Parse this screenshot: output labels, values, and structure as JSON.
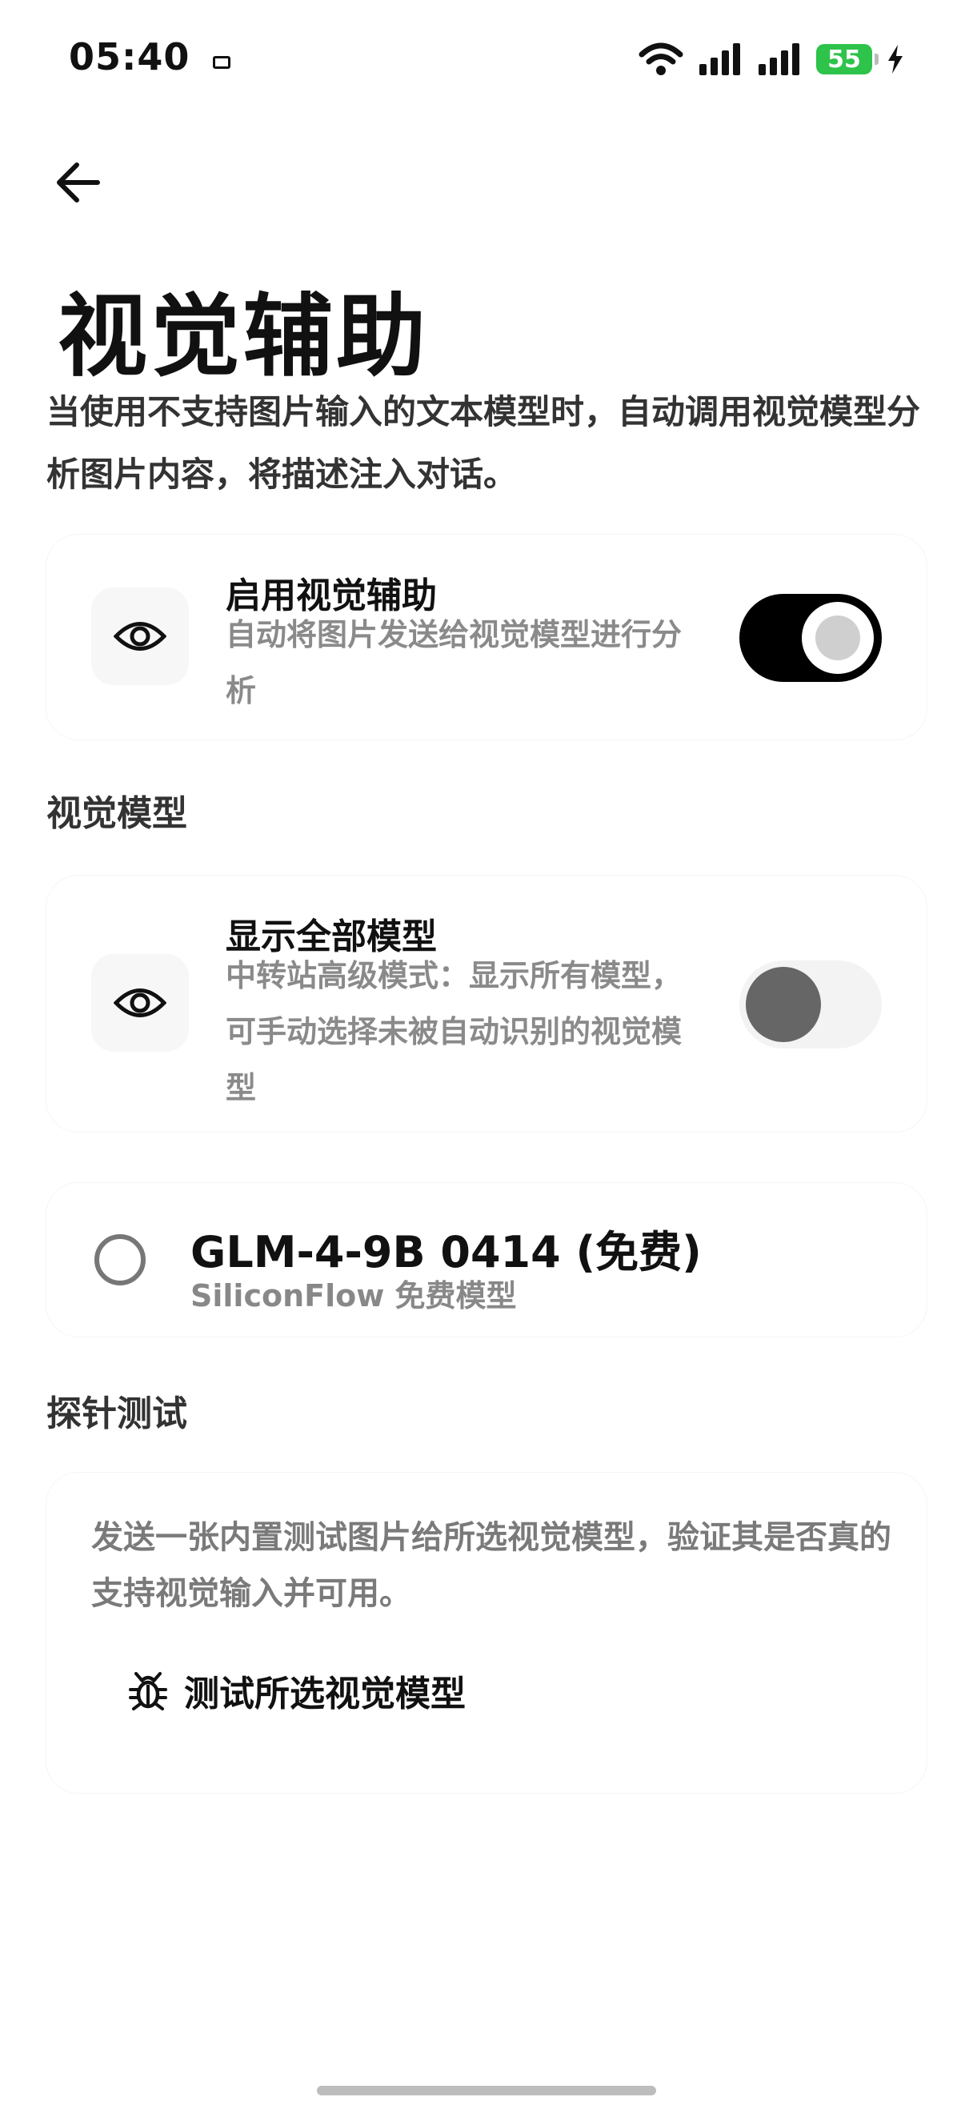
{
  "status_bar": {
    "time": "05:40",
    "battery": "55"
  },
  "header": {
    "back_icon": "arrow-left-icon",
    "title": "视觉辅助",
    "description": "当使用不支持图片输入的文本模型时，自动调用视觉模型分析图片内容，将描述注入对话。"
  },
  "enable_card": {
    "icon": "eye-icon",
    "title": "启用视觉辅助",
    "subtitle": "自动将图片发送给视觉模型进行分析",
    "enabled": true
  },
  "vision_model_section": {
    "label": "视觉模型",
    "show_all": {
      "icon": "eye-icon",
      "title": "显示全部模型",
      "subtitle": "中转站高级模式：显示所有模型，可手动选择未被自动识别的视觉模型",
      "enabled": false
    },
    "models": [
      {
        "name": "GLM-4-9B 0414 (免费)",
        "provider": "SiliconFlow 免费模型",
        "selected": false
      }
    ]
  },
  "probe_section": {
    "label": "探针测试",
    "description": "发送一张内置测试图片给所选视觉模型，验证其是否真的支持视觉输入并可用。",
    "button_icon": "bug-icon",
    "button_label": "测试所选视觉模型"
  }
}
